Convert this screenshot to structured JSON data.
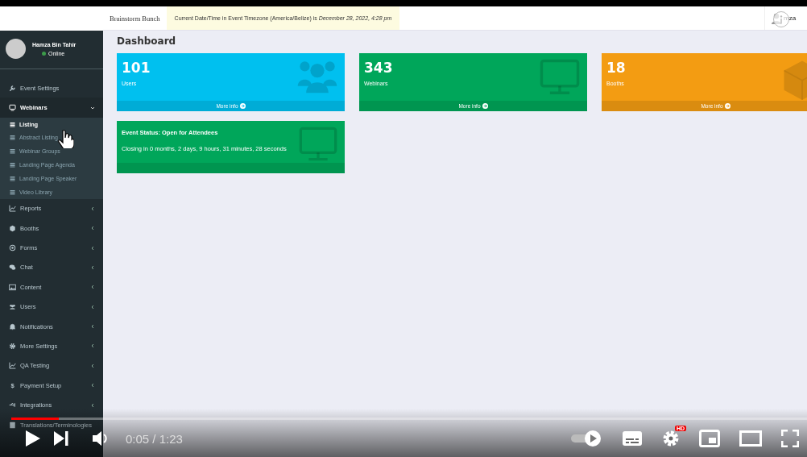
{
  "header": {
    "site_name": "Brainstorm Bunch",
    "notice": "Current Date/Time in Event Timezone (America/Belize) is *December 28, 2022, 4:28 pm*",
    "user": "mza"
  },
  "sidebar": {
    "user": {
      "name": "Hamza Bin Tahir",
      "status": "Online"
    },
    "items": [
      {
        "label": "Event Settings",
        "kind": "link",
        "expanded": false
      },
      {
        "label": "Webinars",
        "kind": "menu",
        "expanded": true,
        "children": [
          {
            "label": "Listing",
            "selected": true
          },
          {
            "label": "Abstract Listing",
            "selected": false
          },
          {
            "label": "Webinar Groups",
            "selected": false
          },
          {
            "label": "Landing Page Agenda",
            "selected": false
          },
          {
            "label": "Landing Page Speaker",
            "selected": false
          },
          {
            "label": "Video Library",
            "selected": false
          }
        ]
      },
      {
        "label": "Reports",
        "kind": "menu",
        "expanded": false
      },
      {
        "label": "Booths",
        "kind": "menu",
        "expanded": false
      },
      {
        "label": "Forms",
        "kind": "menu",
        "expanded": false
      },
      {
        "label": "Chat",
        "kind": "menu",
        "expanded": false
      },
      {
        "label": "Content",
        "kind": "menu",
        "expanded": false
      },
      {
        "label": "Users",
        "kind": "menu",
        "expanded": false
      },
      {
        "label": "Notifications",
        "kind": "menu",
        "expanded": false
      },
      {
        "label": "More Settings",
        "kind": "menu",
        "expanded": false
      },
      {
        "label": "QA Testing",
        "kind": "menu",
        "expanded": false
      },
      {
        "label": "Payment Setup",
        "kind": "menu",
        "expanded": false,
        "glyph": "$"
      },
      {
        "label": "Integrations",
        "kind": "menu",
        "expanded": false
      },
      {
        "label": "Translations/Terminologies",
        "kind": "link",
        "expanded": false
      }
    ]
  },
  "dashboard": {
    "title": "Dashboard",
    "stats": [
      {
        "value": "101",
        "label": "Users",
        "footer": "More info",
        "kind": "users",
        "color": "#00c0ef"
      },
      {
        "value": "343",
        "label": "Webinars",
        "footer": "More info",
        "kind": "monitor",
        "color": "#00a65a"
      },
      {
        "value": "18",
        "label": "Booths",
        "footer": "More info",
        "kind": "cube",
        "color": "#f39c12"
      }
    ],
    "status_card": {
      "title": "Event Status: Open for Attendees",
      "text": "Closing in 0 months, 2 days, 9 hours, 31 minutes, 28 seconds",
      "color": "#00a65a"
    }
  },
  "player": {
    "time": "0:05 / 1:23",
    "progress": {
      "level": 0.06
    },
    "autoplay": {
      "on": true
    },
    "quality_badge": "HD"
  }
}
